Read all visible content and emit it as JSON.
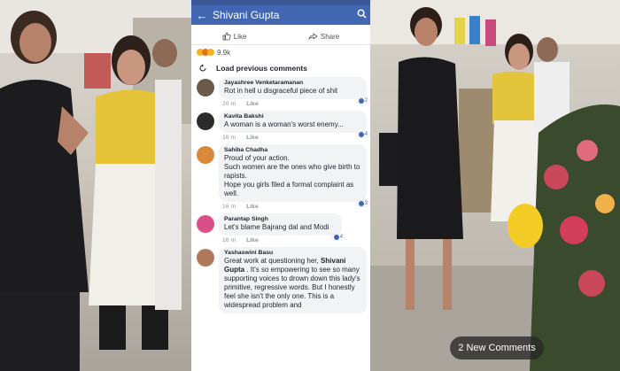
{
  "header": {
    "title": "Shivani Gupta",
    "back_icon": "back-arrow-icon",
    "search_icon": "search-icon"
  },
  "actions": {
    "like_label": "Like",
    "share_label": "Share"
  },
  "reactions": {
    "count": "9.9k"
  },
  "load_previous": "Load previous comments",
  "comments": [
    {
      "name": "Jayashree Venketaramanan",
      "text": "Rot in hell u disgraceful piece of shit",
      "time": "20 m",
      "like": "Like",
      "likes": "2",
      "avatar_color": "#6b5a4a"
    },
    {
      "name": "Kavita Bakshi",
      "text": "A woman is a woman's worst enemy...",
      "time": "16 m",
      "like": "Like",
      "likes": "4",
      "avatar_color": "#2c2c2c"
    },
    {
      "name": "Sahiba Chadha",
      "text": "Proud of your action.\nSuch women are the ones who give birth to rapists.\nHope you girls filed a formal complaint as well.",
      "time": "16 m",
      "like": "Like",
      "likes": "3",
      "avatar_color": "#d88a3a"
    },
    {
      "name": "Parantap Singh",
      "text": "Let's blame Bajrang dal and Modi",
      "time": "16 m",
      "like": "Like",
      "likes": "4",
      "avatar_color": "#d94f8a"
    },
    {
      "name": "Yashaswini Basu",
      "text_before": "Great work at questioning her, ",
      "text_bold": "Shivani Gupta",
      "text_after": " . It's so empowering to see so many supporting voices to drown down this lady's primitive, regressive words. But I honestly feel she isn't the only one. This is a widespread problem and",
      "avatar_color": "#b07a5a"
    }
  ],
  "new_comments": "2 New Comments",
  "colors": {
    "facebook_blue": "#4267b2",
    "bubble_bg": "#f2f3f5"
  }
}
